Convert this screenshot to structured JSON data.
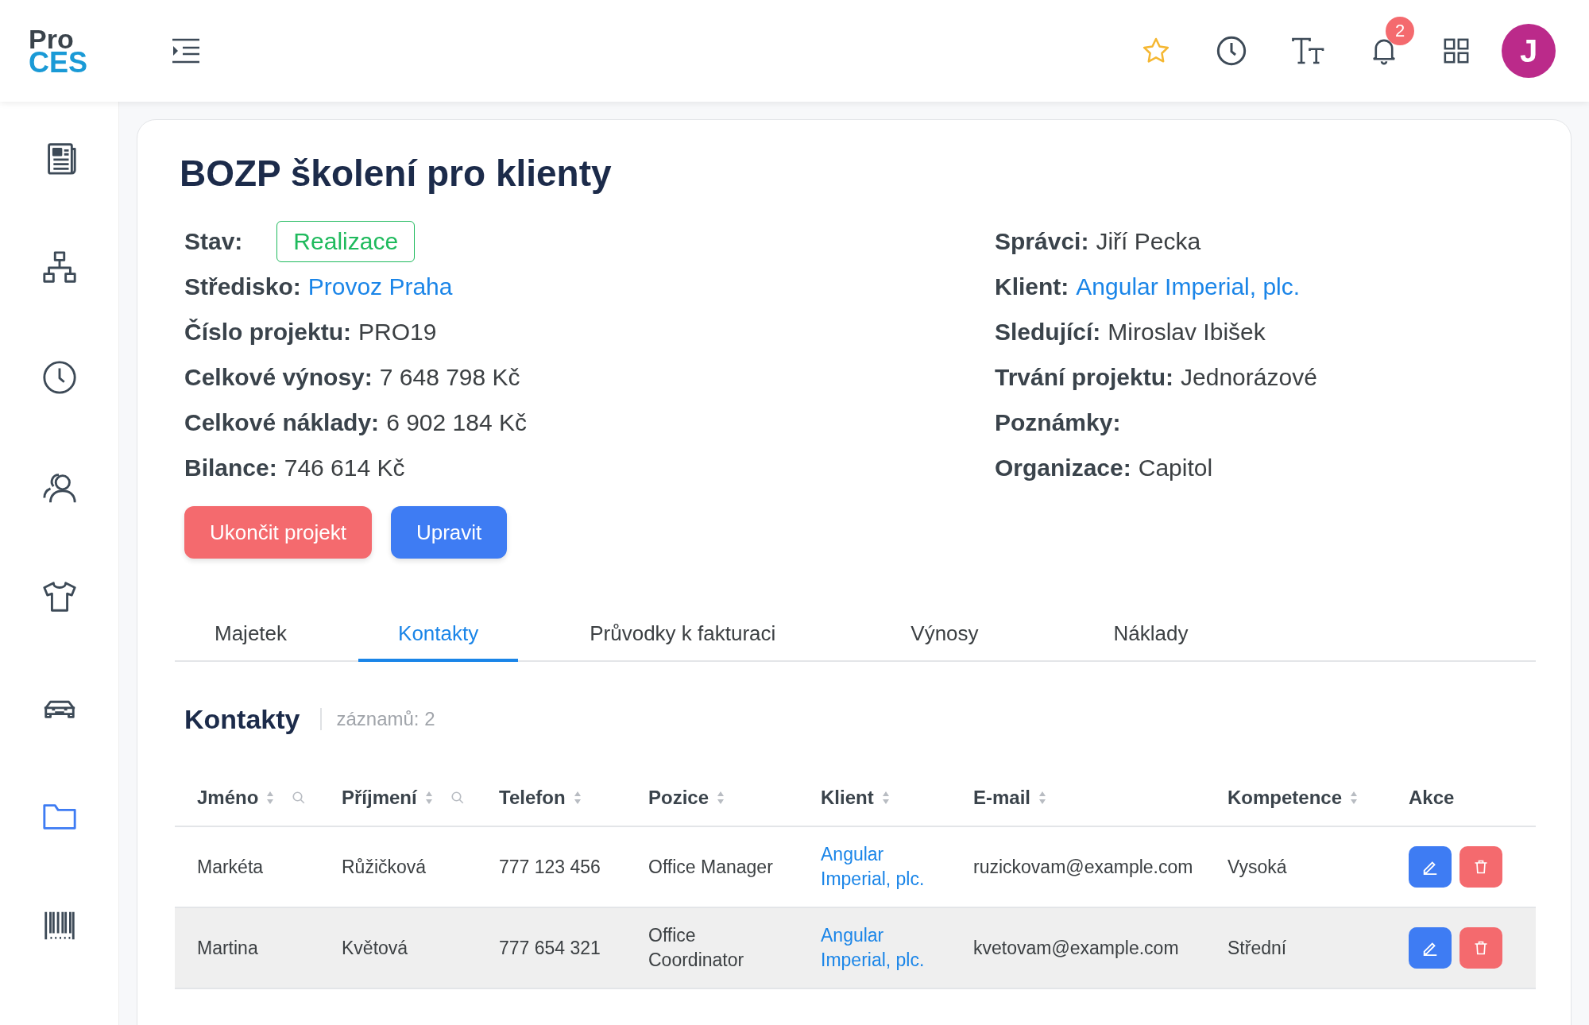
{
  "logo": {
    "line1": "Pro",
    "line2": "CES"
  },
  "topbar": {
    "notification_count": "2",
    "avatar_initial": "J"
  },
  "sidebar": {
    "items": [
      {
        "selected": false
      },
      {
        "selected": false
      },
      {
        "selected": false
      },
      {
        "selected": false
      },
      {
        "selected": false
      },
      {
        "selected": false
      },
      {
        "selected": true
      },
      {
        "selected": false
      }
    ]
  },
  "project": {
    "title": "BOZP školení pro klienty",
    "fields_left": [
      {
        "label": "Stav:",
        "value": "Realizace",
        "kind": "badge"
      },
      {
        "label": "Středisko:",
        "value": "Provoz Praha",
        "kind": "link"
      },
      {
        "label": "Číslo projektu:",
        "value": "PRO19",
        "kind": "text"
      },
      {
        "label": "Celkové výnosy:",
        "value": "7 648 798 Kč",
        "kind": "text"
      },
      {
        "label": "Celkové náklady:",
        "value": "6 902 184 Kč",
        "kind": "text"
      },
      {
        "label": "Bilance:",
        "value": "746 614 Kč",
        "kind": "text"
      }
    ],
    "fields_right": [
      {
        "label": "Správci:",
        "value": "Jiří Pecka",
        "kind": "text"
      },
      {
        "label": "Klient:",
        "value": "Angular Imperial, plc.",
        "kind": "link"
      },
      {
        "label": "Sledující:",
        "value": "Miroslav Ibišek",
        "kind": "text"
      },
      {
        "label": "Trvání projektu:",
        "value": "Jednorázové",
        "kind": "text"
      },
      {
        "label": "Poznámky:"
      },
      {
        "label": "Organizace:",
        "value": "Capitol",
        "kind": "text"
      }
    ],
    "buttons": [
      {
        "label": "Ukončit projekt",
        "kind": "danger"
      },
      {
        "label": "Upravit",
        "kind": "primary"
      }
    ]
  },
  "tabs": [
    {
      "label": "Majetek",
      "selected": false
    },
    {
      "label": "Kontakty",
      "selected": true
    },
    {
      "label": "Průvodky k fakturaci",
      "selected": false
    },
    {
      "label": "Výnosy",
      "selected": false
    },
    {
      "label": "Náklady",
      "selected": false
    }
  ],
  "contacts": {
    "title": "Kontakty",
    "count": "záznamů: 2",
    "columns": [
      {
        "label": "Jméno",
        "sortable": true,
        "searchable": true
      },
      {
        "label": "Příjmení",
        "sortable": true,
        "searchable": true
      },
      {
        "label": "Telefon",
        "sortable": true,
        "searchable": false
      },
      {
        "label": "Pozice",
        "sortable": true,
        "searchable": false
      },
      {
        "label": "Klient",
        "sortable": true,
        "searchable": false
      },
      {
        "label": "E-mail",
        "sortable": true,
        "searchable": false
      },
      {
        "label": "Kompetence",
        "sortable": true,
        "searchable": false
      },
      {
        "label": "Akce",
        "sortable": false,
        "searchable": false
      }
    ],
    "rows": [
      {
        "highlighted": false,
        "cells": [
          "Markéta",
          "Růžičková",
          "777 123 456",
          "Office Manager",
          "Angular Imperial, plc.",
          "ruzickovam@example.com",
          "Vysoká"
        ]
      },
      {
        "highlighted": true,
        "cells": [
          "Martina",
          "Květová",
          "777 654 321",
          "Office Coordinator",
          "Angular Imperial, plc.",
          "kvetovam@example.com",
          "Střední"
        ]
      }
    ]
  }
}
